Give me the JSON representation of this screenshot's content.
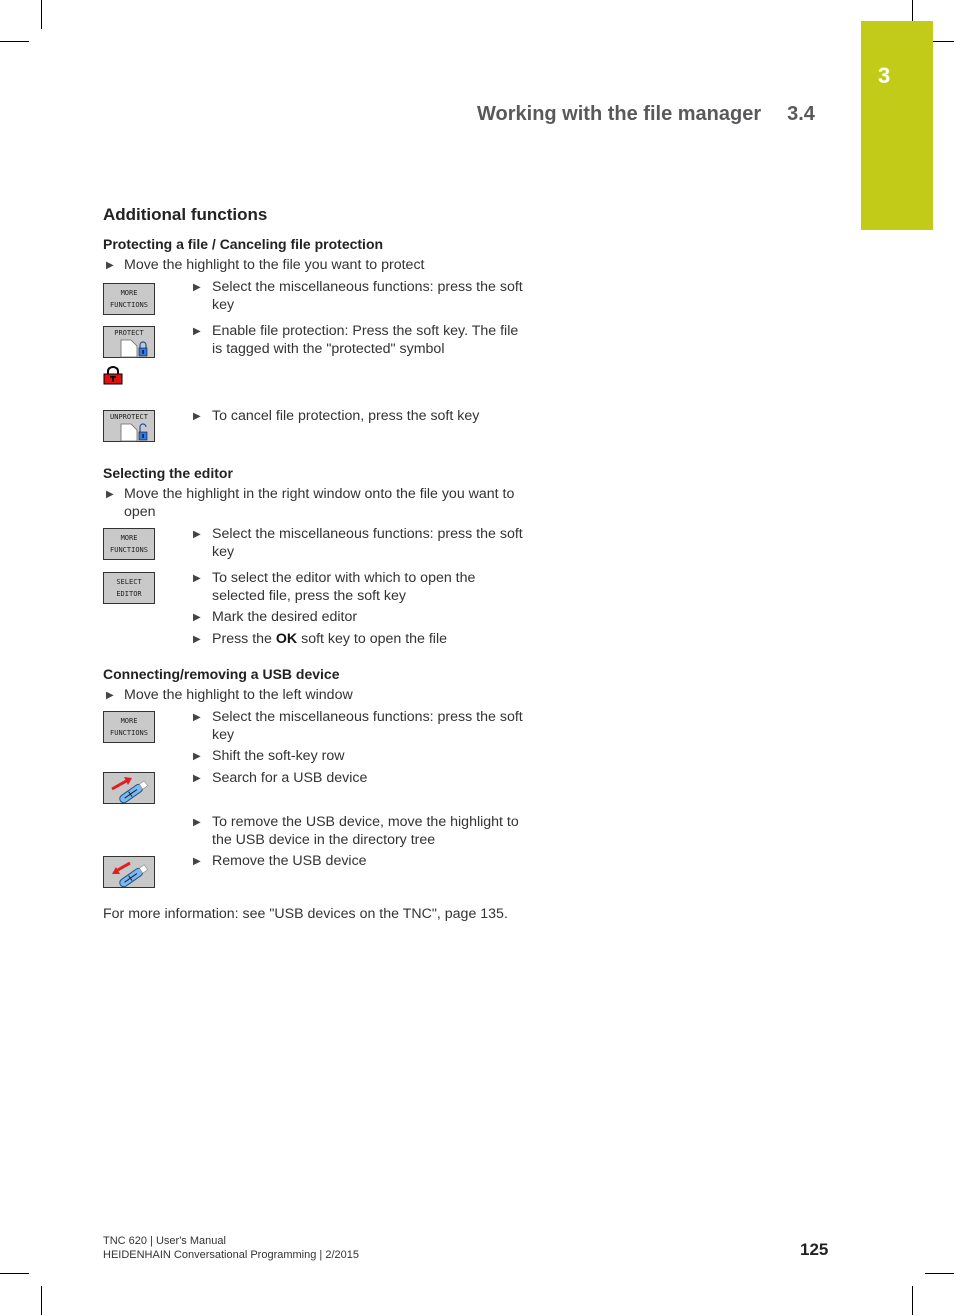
{
  "chapter": {
    "number": "3",
    "color": "#c3cb19"
  },
  "running_head": {
    "title": "Working with the file manager",
    "section": "3.4"
  },
  "heading": "Additional functions",
  "sections": [
    {
      "title": "Protecting a file / Canceling file protection",
      "intro": "Move the highlight to the file you want to protect",
      "steps": [
        {
          "softkey": [
            "MORE",
            "FUNCTIONS"
          ],
          "text": [
            "Select the miscellaneous functions: press the  soft",
            "key"
          ]
        },
        {
          "softkey": [
            "PROTECT"
          ],
          "text": [
            "Enable file protection: Press the  soft key. The file",
            "is tagged with the \"protected\" symbol"
          ]
        },
        {
          "softkey": [
            "UNPROTECT"
          ],
          "text": [
            "To cancel file protection, press the  soft key"
          ]
        }
      ],
      "protected_symbol": "padlock-red"
    },
    {
      "title": "Selecting the editor",
      "intro": [
        "Move the highlight in the right window onto the file you want to",
        "open"
      ],
      "steps": [
        {
          "softkey": [
            "MORE",
            "FUNCTIONS"
          ],
          "text": [
            "Select the miscellaneous functions: press the  soft",
            "key"
          ]
        },
        {
          "softkey": [
            "SELECT",
            "EDITOR"
          ],
          "text": [
            "To select the editor with which to open the",
            "selected file, press the  soft key"
          ]
        },
        {
          "text": [
            "Mark the desired editor"
          ]
        },
        {
          "text_pre": "Press the ",
          "text_bold": "OK",
          "text_post": " soft key to open the file"
        }
      ]
    },
    {
      "title": "Connecting/removing a USB device",
      "intro": "Move the highlight to the left window",
      "steps": [
        {
          "softkey": [
            "MORE",
            "FUNCTIONS"
          ],
          "text": [
            "Select the miscellaneous functions: press the  soft",
            "key"
          ]
        },
        {
          "text": [
            "Shift the soft-key row"
          ]
        },
        {
          "softkey_icon": "usb-connect",
          "text": [
            "Search for a USB device"
          ]
        },
        {
          "text": [
            "To remove the USB device, move the highlight to",
            "the USB device in the directory tree"
          ]
        },
        {
          "softkey_icon": "usb-remove",
          "text": [
            "Remove the USB device"
          ]
        }
      ]
    }
  ],
  "more_info": "For more information: see \"USB devices on the TNC\", page 135.",
  "footer": {
    "line1": "TNC 620 | User's Manual",
    "line2": "HEIDENHAIN Conversational Programming | 2/2015",
    "page": "125"
  }
}
